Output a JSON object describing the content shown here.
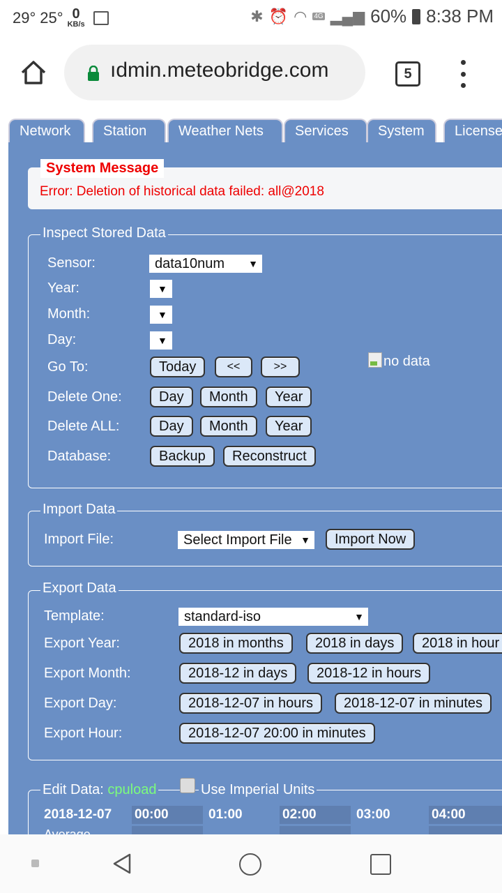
{
  "status_bar": {
    "temp1": "29°",
    "temp2": "25°",
    "speed_value": "0",
    "speed_unit": "KB/s",
    "battery": "60%",
    "time": "8:38 PM",
    "network": "4G"
  },
  "browser": {
    "url": "ıdmin.meteobridge.com",
    "tab_count": "5"
  },
  "tabs": [
    "Network",
    "Station",
    "Weather Nets",
    "Services",
    "System",
    "License"
  ],
  "system_message": {
    "title": "System Message",
    "text": "Error: Deletion of historical data failed: all@2018"
  },
  "inspect": {
    "legend": "Inspect Stored Data",
    "sensor_label": "Sensor:",
    "sensor_value": "data10num",
    "year_label": "Year:",
    "month_label": "Month:",
    "day_label": "Day:",
    "goto_label": "Go To:",
    "goto_buttons": [
      "Today",
      "<<",
      ">>"
    ],
    "delete_one_label": "Delete One:",
    "delete_one_buttons": [
      "Day",
      "Month",
      "Year"
    ],
    "delete_all_label": "Delete ALL:",
    "delete_all_buttons": [
      "Day",
      "Month",
      "Year"
    ],
    "database_label": "Database:",
    "database_buttons": [
      "Backup",
      "Reconstruct"
    ],
    "no_data": "no data"
  },
  "import": {
    "legend": "Import Data",
    "file_label": "Import File:",
    "file_select": "Select Import File",
    "import_button": "Import Now"
  },
  "export": {
    "legend": "Export Data",
    "template_label": "Template:",
    "template_value": "standard-iso",
    "year_label": "Export Year:",
    "year_buttons": [
      "2018 in months",
      "2018 in days",
      "2018 in hour"
    ],
    "month_label": "Export Month:",
    "month_buttons": [
      "2018-12 in days",
      "2018-12 in hours"
    ],
    "day_label": "Export Day:",
    "day_buttons": [
      "2018-12-07 in hours",
      "2018-12-07 in minutes"
    ],
    "hour_label": "Export Hour:",
    "hour_buttons": [
      "2018-12-07 20:00 in minutes"
    ]
  },
  "edit": {
    "legend": "Edit Data:",
    "sensor": "cpuload",
    "imperial_label": "Use Imperial Units",
    "date": "2018-12-07",
    "hours": [
      "00:00",
      "01:00",
      "02:00",
      "03:00",
      "04:00"
    ],
    "row_label": "Average"
  },
  "colors": {
    "panel": "#6a8fc5",
    "button": "#dbe8f8",
    "error": "#e00000",
    "sensor_link": "#7cfc7c"
  }
}
